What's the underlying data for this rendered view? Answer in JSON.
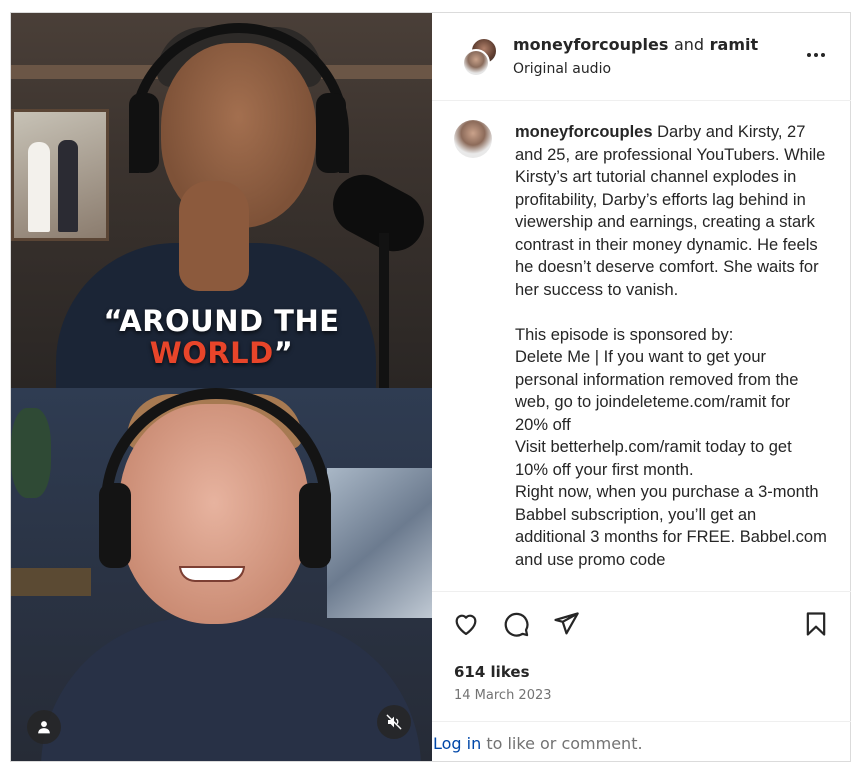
{
  "media": {
    "caption_line1": "“AROUND THE",
    "caption_line2": "WORLD",
    "caption_line2_quote": "”",
    "caption_accent_color": "#e8452a",
    "profile_icon": "user-icon",
    "mute_icon": "speaker-muted-icon"
  },
  "header": {
    "user1": "moneyforcouples",
    "and": "and",
    "user2": "ramit",
    "subtitle": "Original audio",
    "more_icon": "more-horizontal-icon"
  },
  "caption": {
    "username": "moneyforcouples",
    "text": " Darby and Kirsty, 27 and 25, are professional YouTubers. While Kirsty’s art tutorial channel explodes in profitability, Darby’s efforts lag behind in viewership and earnings, creating a stark contrast in their money dynamic. He feels he doesn’t deserve comfort. She waits for her success to vanish.\n\nThis episode is sponsored by:\nDelete Me | If you want to get your personal information removed from the web, go to joindeleteme.com/ramit for 20% off\nVisit betterhelp.com/ramit today to get 10% off your first month.\nRight now, when you purchase a 3-month Babbel subscription, you’ll get an additional 3 months for FREE. Babbel.com and use promo code"
  },
  "actions": {
    "like_icon": "heart-icon",
    "comment_icon": "comment-icon",
    "share_icon": "send-icon",
    "save_icon": "bookmark-icon"
  },
  "likes": "614 likes",
  "date": "14 March 2023",
  "footer": {
    "login": "Log in",
    "rest": " to like or comment."
  }
}
